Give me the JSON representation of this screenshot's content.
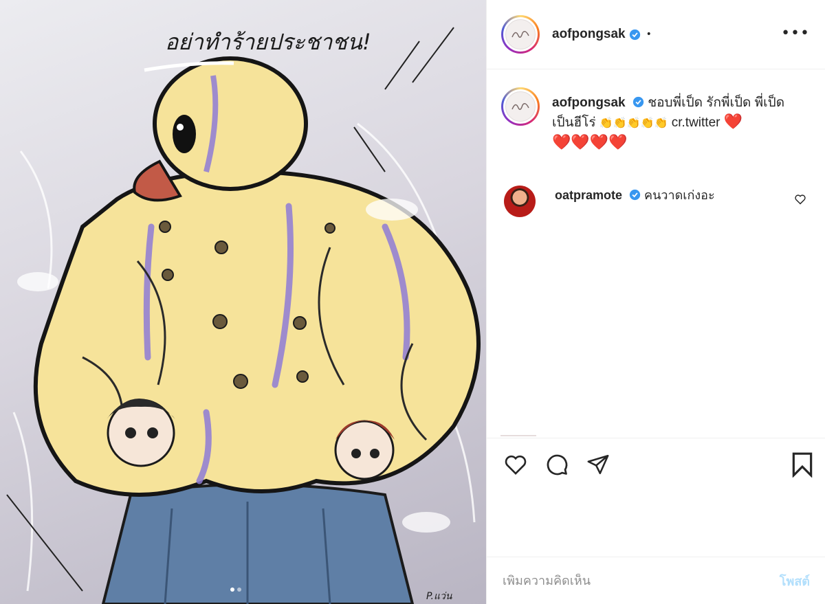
{
  "post": {
    "image_title_text": "อย่าทำร้ายประชาชน!",
    "carousel_dots": 2,
    "active_dot": 1
  },
  "header": {
    "username": "aofpongsak",
    "verified": true,
    "separator": "•",
    "more_label": "•••"
  },
  "caption": {
    "username": "aofpongsak",
    "text_part1": "ชอบพี่เป็ด รักพี่เป็ด พี่เป็ดเป็นฮีโร่",
    "emoji_row": "👏👏👏👏👏",
    "credit": "cr.twitter",
    "hearts": "❤️",
    "hearts_row2": "❤️❤️❤️❤️"
  },
  "comments": [
    {
      "username": "oatpramote",
      "verified": true,
      "text": "คนวาดเก่งอะ"
    }
  ],
  "actions": {
    "like": "heart-outline",
    "comment": "speech-bubble",
    "share": "paper-plane",
    "save": "bookmark"
  },
  "add_comment": {
    "placeholder": "เพิ่มความคิดเห็น",
    "post_label": "โพสต์"
  },
  "colors": {
    "verified_blue": "#3897f0",
    "post_button_disabled": "#b2dffc",
    "heart_red": "#e0182d"
  }
}
